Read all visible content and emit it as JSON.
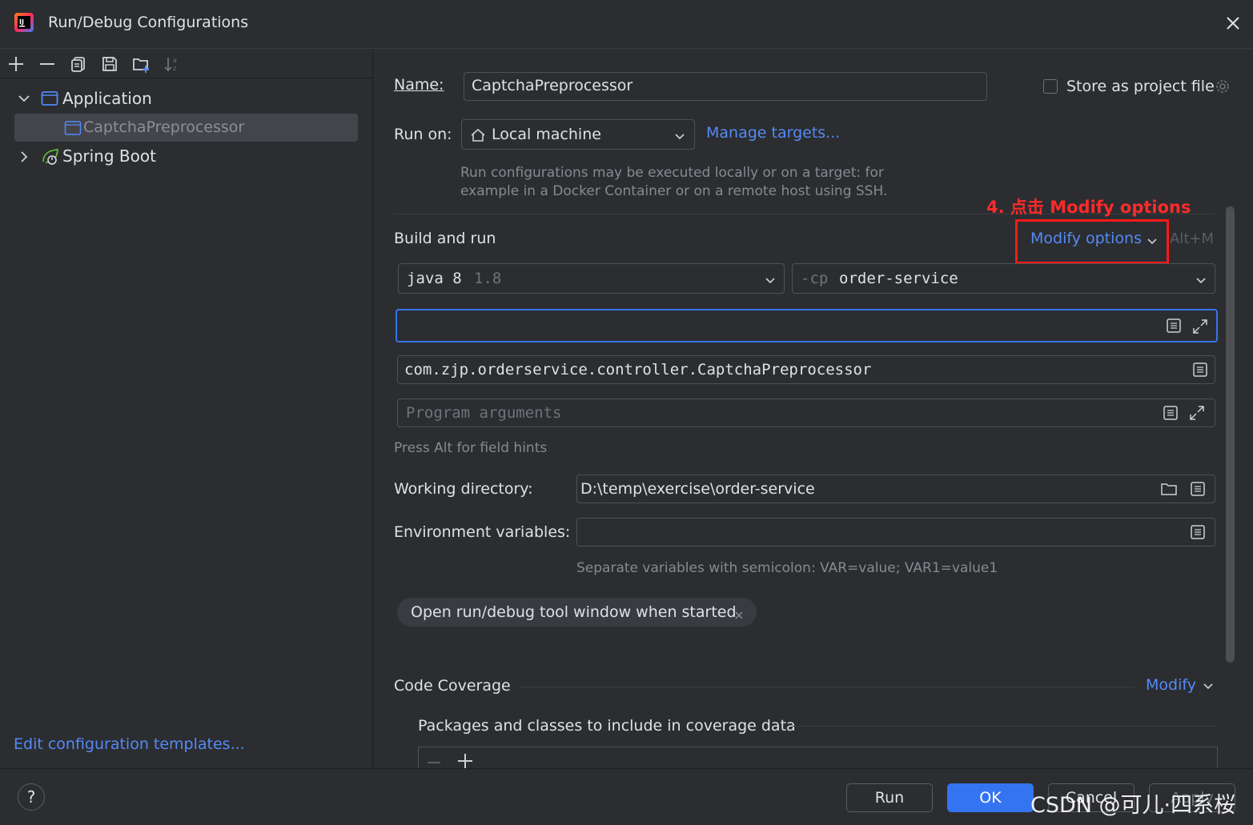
{
  "window": {
    "title": "Run/Debug Configurations"
  },
  "toolbar": {
    "icons": [
      "add-icon",
      "remove-icon",
      "copy-icon",
      "save-icon",
      "new-folder-icon",
      "sort-icon"
    ]
  },
  "tree": {
    "application": {
      "label": "Application"
    },
    "selected_item": {
      "label": "CaptchaPreprocessor"
    },
    "spring_boot": {
      "label": "Spring Boot"
    }
  },
  "sidebar": {
    "edit_templates_link": "Edit configuration templates..."
  },
  "form": {
    "name_label": "Name:",
    "name_value": "CaptchaPreprocessor",
    "store_as_project_file": "Store as project file",
    "run_on_label": "Run on:",
    "run_on_value": "Local machine",
    "manage_targets": "Manage targets...",
    "run_on_hint_line1": "Run configurations may be executed locally or on a target: for",
    "run_on_hint_line2": "example in a Docker Container or on a remote host using SSH."
  },
  "build_and_run": {
    "title": "Build and run",
    "modify_options": "Modify options",
    "shortcut": "Alt+M",
    "annotation": "4. 点击 Modify options",
    "jdk_value": "java 8",
    "jdk_version": "1.8",
    "cp_prefix": "-cp",
    "cp_value": "order-service",
    "vm_options_value": "",
    "main_class": "com.zjp.orderservice.controller.CaptchaPreprocessor",
    "program_args_placeholder": "Program arguments",
    "field_hint": "Press Alt for field hints",
    "working_dir_label": "Working directory:",
    "working_dir_value": "D:\\temp\\exercise\\order-service",
    "env_label": "Environment variables:",
    "env_value": "",
    "env_hint": "Separate variables with semicolon: VAR=value; VAR1=value1",
    "tag_chip": "Open run/debug tool window when started"
  },
  "coverage": {
    "title": "Code Coverage",
    "modify": "Modify",
    "packages_label": "Packages and classes to include in coverage data"
  },
  "footer": {
    "help": "?",
    "run": "Run",
    "ok": "OK",
    "cancel": "Cancel",
    "apply": "Apply",
    "watermark": "CSDN @可儿·四系桜"
  },
  "colors": {
    "background": "#2b2d30",
    "accent": "#3574f0",
    "link": "#548af7",
    "annotation": "#ff2a2a",
    "selection": "#43454a"
  }
}
